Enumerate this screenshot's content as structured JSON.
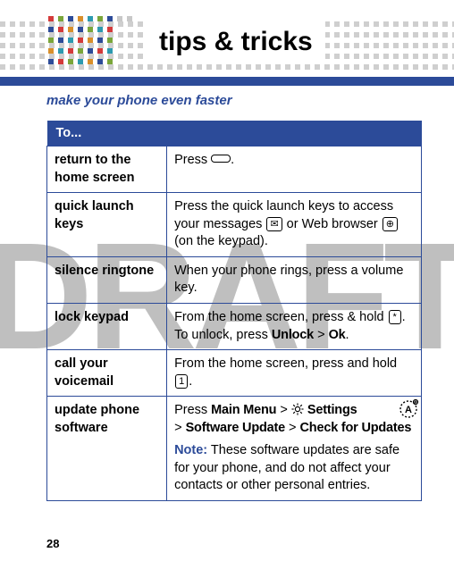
{
  "header": {
    "title": "tips & tricks"
  },
  "subheading": "make your phone even faster",
  "table": {
    "header": "To...",
    "rows": [
      {
        "label": "return to the home screen",
        "desc_pre": "Press ",
        "icon": "home-key-icon",
        "desc_post": "."
      },
      {
        "label": "quick launch keys",
        "desc_pre": "Press the quick launch keys to access your messages ",
        "icon1": "message-key-icon",
        "desc_mid": " or Web browser ",
        "icon2": "browser-key-icon",
        "desc_post": " (on the keypad)."
      },
      {
        "label": "silence ringtone",
        "desc": "When your phone rings, press a volume key."
      },
      {
        "label": "lock keypad",
        "desc_pre": "From the home screen, press & hold ",
        "icon": "star-key-icon",
        "icon_text": "*",
        "desc_mid": ". To unlock, press ",
        "menu1": "Unlock",
        "menu_gt": " > ",
        "menu2": "Ok",
        "desc_post": "."
      },
      {
        "label": "call your voicemail",
        "desc_pre": "From the home screen, press and hold ",
        "icon": "one-key-icon",
        "icon_text": "1",
        "desc_post": "."
      },
      {
        "label": "update phone software",
        "line1_pre": "Press ",
        "menu_main": "Main Menu",
        "gt": " > ",
        "menu_settings": "Settings",
        "menu_su": "Software Update",
        "menu_cfu": "Check for Updates",
        "note_label": "Note:",
        "note_text": " These software updates are safe for your phone, and do not affect your contacts or other personal entries."
      }
    ]
  },
  "page_number": "28",
  "watermark": "DRAFT"
}
